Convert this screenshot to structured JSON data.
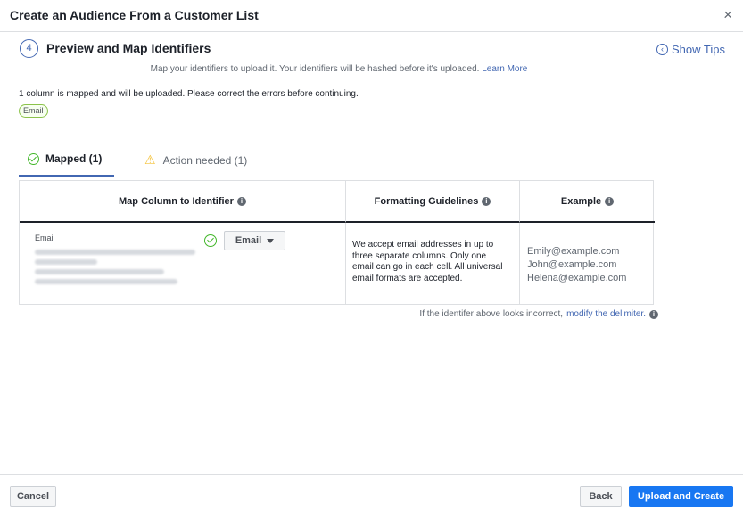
{
  "dialog": {
    "title": "Create an Audience From a Customer List",
    "close_label": "×"
  },
  "step": {
    "number": "4",
    "title": "Preview and Map Identifiers",
    "show_tips_label": "Show Tips",
    "subtitle": "Map your identifiers to upload it. Your identifiers will be hashed before it's uploaded.",
    "learn_more": "Learn More"
  },
  "status": {
    "message": "1 column is mapped and will be uploaded. Please correct the errors before continuing.",
    "pill": "Email"
  },
  "tabs": [
    {
      "label": "Mapped (1)",
      "icon": "check-circle-icon",
      "active": true
    },
    {
      "label": "Action needed (1)",
      "icon": "warning-icon",
      "active": false
    }
  ],
  "table": {
    "headers": [
      {
        "label": "Map Column to Identifier"
      },
      {
        "label": "Formatting Guidelines"
      },
      {
        "label": "Example"
      }
    ],
    "row": {
      "column_label": "Email",
      "identifier": "Email",
      "guidelines": "We accept email addresses in up to three separate columns. Only one email can go in each cell. All universal email formats are accepted.",
      "examples": [
        "Emily@example.com",
        "John@example.com",
        "Helena@example.com"
      ]
    }
  },
  "delimiter_note": {
    "text": "If the identifer above looks incorrect,",
    "link": "modify the delimiter."
  },
  "footer": {
    "cancel": "Cancel",
    "back": "Back",
    "upload": "Upload and Create"
  },
  "colors": {
    "accent": "#4267b2",
    "primary_button": "#1877f2",
    "success": "#42b72a",
    "warning": "#f5c33b"
  }
}
